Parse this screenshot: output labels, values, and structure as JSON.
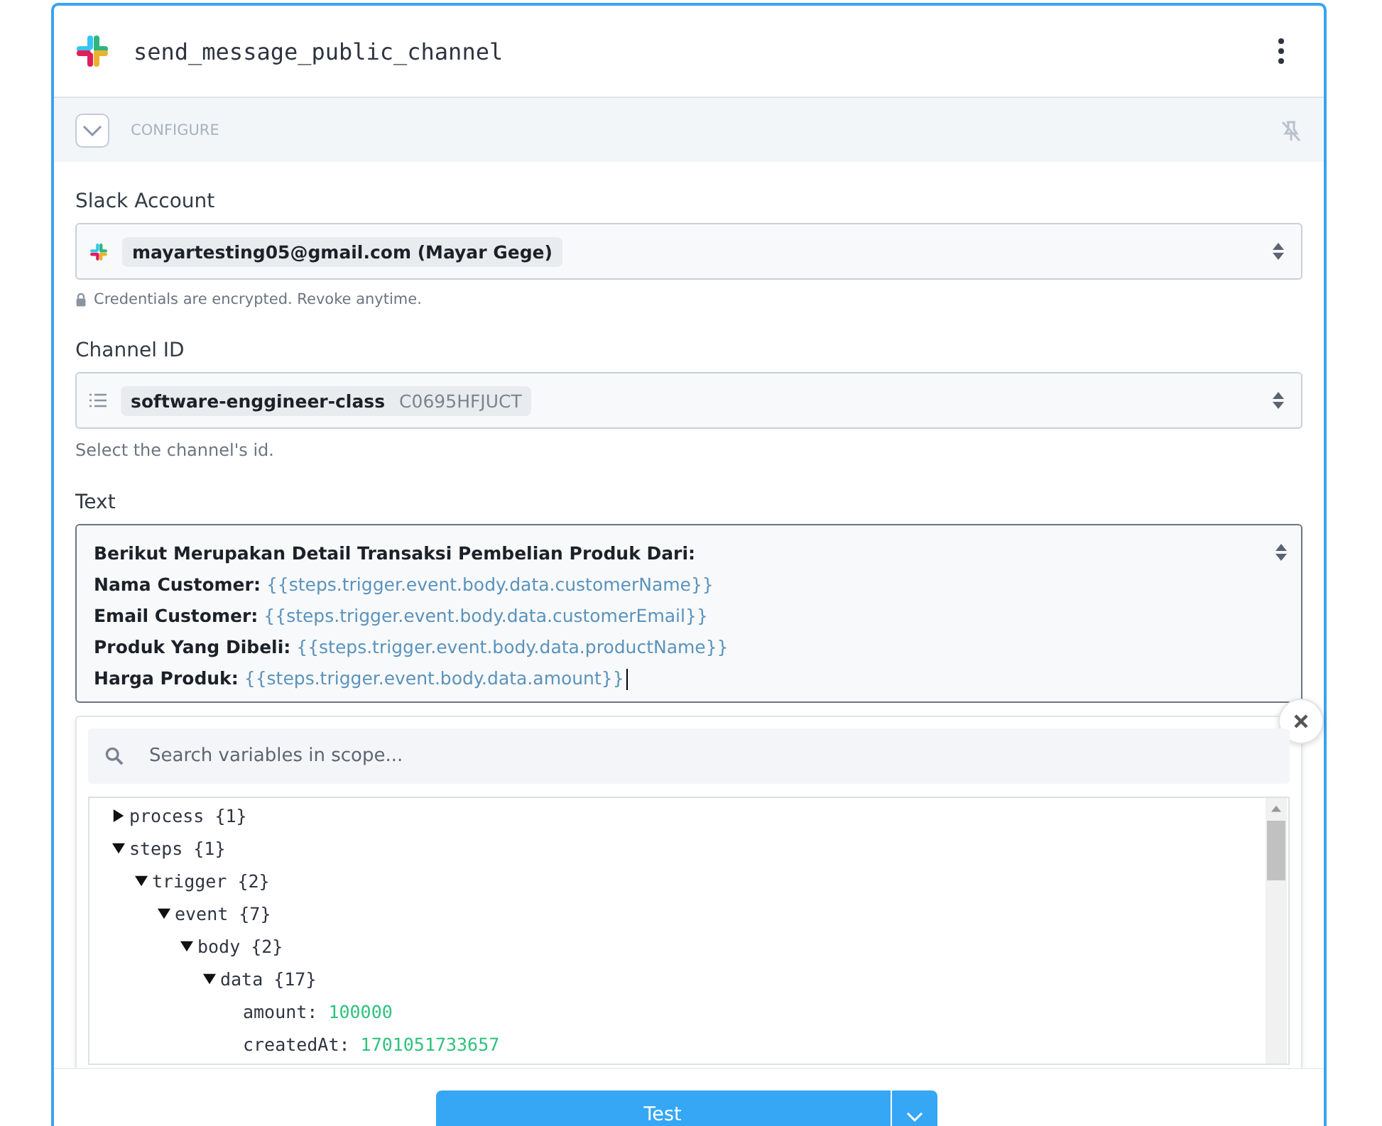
{
  "step": {
    "title": "send_message_public_channel"
  },
  "configure": {
    "label": "CONFIGURE",
    "expanded": false
  },
  "fields": [
    {
      "kind": "account",
      "label": "Slack Account",
      "value": "mayartesting05@gmail.com (Mayar Gege)",
      "note": "Credentials are encrypted. Revoke anytime."
    },
    {
      "kind": "channel",
      "label": "Channel ID",
      "value": "software-enggineer-class",
      "sub": "C0695HFJUCT",
      "note": "Select the channel's id."
    }
  ],
  "text_field": {
    "label": "Text",
    "lines": [
      {
        "label": "Berikut Merupakan Detail Transaksi Pembelian Produk Dari:"
      },
      {
        "label": "Nama Customer:",
        "variable": "{{steps.trigger.event.body.data.customerName}}"
      },
      {
        "label": "Email Customer:",
        "variable": "{{steps.trigger.event.body.data.customerEmail}}"
      },
      {
        "label": "Produk Yang Dibeli:",
        "variable": "{{steps.trigger.event.body.data.productName}}"
      },
      {
        "label": "Harga Produk:",
        "variable": "{{steps.trigger.event.body.data.amount}}"
      }
    ]
  },
  "variables": {
    "search": {
      "placeholder": "Search variables in scope..."
    },
    "tree": [
      {
        "kind": "object",
        "label": "process",
        "count": "{1}",
        "expanded": false
      },
      {
        "kind": "object",
        "label": "steps",
        "count": "{1}",
        "expanded": true,
        "children": [
          {
            "kind": "object",
            "label": "trigger",
            "count": "{2}",
            "expanded": true,
            "children": [
              {
                "kind": "object",
                "label": "event",
                "count": "{7}",
                "expanded": true,
                "children": [
                  {
                    "kind": "object",
                    "label": "body",
                    "count": "{2}",
                    "expanded": true,
                    "children": [
                      {
                        "kind": "object",
                        "label": "data",
                        "count": "{17}",
                        "expanded": true,
                        "children": [
                          {
                            "kind": "value",
                            "label": "amount:",
                            "value": "100000"
                          },
                          {
                            "kind": "value",
                            "label": "createdAt:",
                            "value": "1701051733657"
                          }
                        ]
                      }
                    ]
                  }
                ]
              }
            ]
          }
        ]
      }
    ]
  },
  "footer": {
    "button": "Test"
  }
}
